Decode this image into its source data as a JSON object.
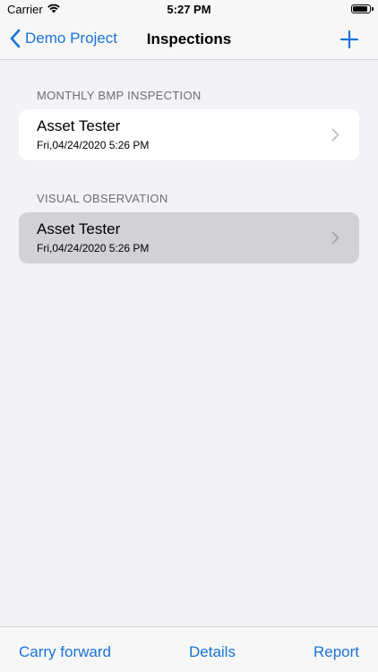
{
  "status_bar": {
    "carrier": "Carrier",
    "time": "5:27 PM"
  },
  "nav": {
    "back_label": "Demo Project",
    "title": "Inspections"
  },
  "sections": [
    {
      "header": "MONTHLY BMP INSPECTION",
      "items": [
        {
          "title": "Asset Tester",
          "subtitle": "Fri,04/24/2020 5:26 PM"
        }
      ]
    },
    {
      "header": "VISUAL OBSERVATION",
      "items": [
        {
          "title": "Asset Tester",
          "subtitle": "Fri,04/24/2020 5:26 PM"
        }
      ]
    }
  ],
  "toolbar": {
    "carry_forward": "Carry forward",
    "details": "Details",
    "report": "Report"
  },
  "colors": {
    "accent": "#1a73d9",
    "background": "#f2f2f7",
    "selected_cell": "#d1d1d6"
  }
}
